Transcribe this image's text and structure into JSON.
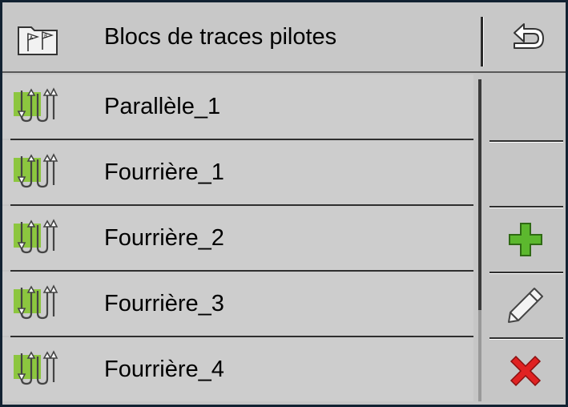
{
  "header": {
    "title": "Blocs de traces pilotes",
    "icon": "ab-flags-folder-icon",
    "back_icon": "back-arrow-icon"
  },
  "list": {
    "items": [
      {
        "label": "Parallèle_1",
        "icon": "guidance-tracks-icon"
      },
      {
        "label": "Fourrière_1",
        "icon": "guidance-tracks-icon"
      },
      {
        "label": "Fourrière_2",
        "icon": "guidance-tracks-icon"
      },
      {
        "label": "Fourrière_3",
        "icon": "guidance-tracks-icon"
      },
      {
        "label": "Fourrière_4",
        "icon": "guidance-tracks-icon"
      }
    ]
  },
  "side_buttons": [
    {
      "icon": "",
      "enabled": false
    },
    {
      "icon": "",
      "enabled": false
    },
    {
      "icon": "plus-icon",
      "color": "#3a9a1a"
    },
    {
      "icon": "pencil-icon"
    },
    {
      "icon": "delete-x-icon",
      "color": "#e02020"
    }
  ],
  "colors": {
    "background": "#c6c6c6",
    "frame": "#122232",
    "accent_green": "#7ec21e"
  }
}
